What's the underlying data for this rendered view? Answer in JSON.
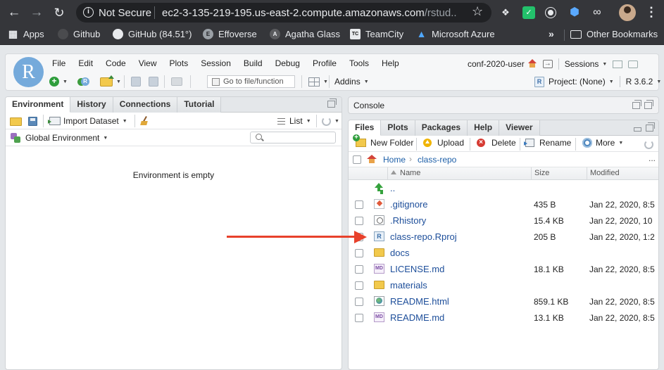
{
  "browser": {
    "not_secure_label": "Not Secure",
    "url_host": "ec2-3-135-219-195.us-east-2.compute.amazonaws.com",
    "url_path": "/rstud...",
    "icons": [
      "back-icon",
      "forward-icon",
      "reload-icon",
      "info-icon",
      "star-icon",
      "dropbox-icon",
      "extension-icon",
      "profile-avatar",
      "menu-icon"
    ]
  },
  "bookmarks": {
    "items": [
      {
        "label": "Apps",
        "icon": "apps-grid-icon"
      },
      {
        "label": "Github",
        "icon": "github-icon"
      },
      {
        "label": "GitHub (84.51°)",
        "icon": "github-icon"
      },
      {
        "label": "Effoverse",
        "icon": "effoverse-icon"
      },
      {
        "label": "Agatha Glass",
        "icon": "agatha-icon"
      },
      {
        "label": "TeamCity",
        "icon": "teamcity-icon"
      },
      {
        "label": "Microsoft Azure",
        "icon": "azure-icon"
      }
    ],
    "more": "»",
    "other": "Other Bookmarks"
  },
  "rstudio": {
    "logo": "R",
    "menus": [
      "File",
      "Edit",
      "Code",
      "View",
      "Plots",
      "Session",
      "Build",
      "Debug",
      "Profile",
      "Tools",
      "Help"
    ],
    "user": "conf-2020-user",
    "sessions_label": "Sessions",
    "goto_placeholder": "Go to file/function",
    "addins_label": "Addins",
    "project_label": "Project: (None)",
    "r_version": "R 3.6.2"
  },
  "left_pane": {
    "tabs": [
      "Environment",
      "History",
      "Connections",
      "Tutorial"
    ],
    "import_label": "Import Dataset",
    "list_label": "List",
    "env_scope": "Global Environment",
    "empty_message": "Environment is empty"
  },
  "console": {
    "label": "Console"
  },
  "files_pane": {
    "tabs": [
      "Files",
      "Plots",
      "Packages",
      "Help",
      "Viewer"
    ],
    "toolbar": {
      "new_folder": "New Folder",
      "upload": "Upload",
      "delete": "Delete",
      "rename": "Rename",
      "more": "More"
    },
    "breadcrumb": [
      "Home",
      "class-repo"
    ],
    "breadcrumb_more": "...",
    "columns": {
      "name": "Name",
      "size": "Size",
      "modified": "Modified"
    },
    "rows": [
      {
        "name": "..",
        "size": "",
        "modified": "",
        "icon": "up-arrow-icon"
      },
      {
        "name": ".gitignore",
        "size": "435 B",
        "modified": "Jan 22, 2020, 8:5",
        "icon": "git-file-icon"
      },
      {
        "name": ".Rhistory",
        "size": "15.4 KB",
        "modified": "Jan 22, 2020, 10",
        "icon": "history-file-icon"
      },
      {
        "name": "class-repo.Rproj",
        "size": "205 B",
        "modified": "Jan 22, 2020, 1:2",
        "icon": "rproj-file-icon"
      },
      {
        "name": "docs",
        "size": "",
        "modified": "",
        "icon": "folder-icon"
      },
      {
        "name": "LICENSE.md",
        "size": "18.1 KB",
        "modified": "Jan 22, 2020, 8:5",
        "icon": "markdown-file-icon"
      },
      {
        "name": "materials",
        "size": "",
        "modified": "",
        "icon": "folder-icon"
      },
      {
        "name": "README.html",
        "size": "859.1 KB",
        "modified": "Jan 22, 2020, 8:5",
        "icon": "html-file-icon"
      },
      {
        "name": "README.md",
        "size": "13.1 KB",
        "modified": "Jan 22, 2020, 8:5",
        "icon": "markdown-file-icon"
      }
    ]
  },
  "annotation": {
    "arrow_color": "#e8412b"
  }
}
